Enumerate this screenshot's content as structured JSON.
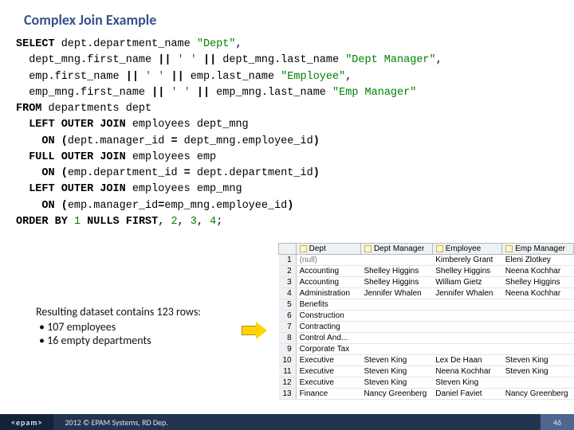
{
  "slide": {
    "title": "Complex Join Example",
    "sql_html": "<span class=\"kw\">SELECT</span> dept.department_name <span class=\"str\">\"Dept\"</span>,\n  dept_mng.first_name <span class=\"kw\">||</span> <span class=\"str\">' '</span> <span class=\"kw\">||</span> dept_mng.last_name <span class=\"str\">\"Dept Manager\"</span>,\n  emp.first_name <span class=\"kw\">||</span> <span class=\"str\">' '</span> <span class=\"kw\">||</span> emp.last_name <span class=\"str\">\"Employee\"</span>,\n  emp_mng.first_name <span class=\"kw\">||</span> <span class=\"str\">' '</span> <span class=\"kw\">||</span> emp_mng.last_name <span class=\"str\">\"Emp Manager\"</span>\n<span class=\"kw\">FROM</span> departments dept\n  <span class=\"kw\">LEFT OUTER JOIN</span> employees dept_mng\n    <span class=\"kw\">ON</span> <span class=\"kw\">(</span>dept.manager_id <span class=\"kw\">=</span> dept_mng.employee_id<span class=\"kw\">)</span>\n  <span class=\"kw\">FULL OUTER JOIN</span> employees emp\n    <span class=\"kw\">ON</span> <span class=\"kw\">(</span>emp.department_id <span class=\"kw\">=</span> dept.department_id<span class=\"kw\">)</span>\n  <span class=\"kw\">LEFT OUTER JOIN</span> employees emp_mng\n    <span class=\"kw\">ON</span> <span class=\"kw\">(</span>emp.manager_id<span class=\"kw\">=</span>emp_mng.employee_id<span class=\"kw\">)</span>\n<span class=\"kw\">ORDER BY</span> <span class=\"str\">1</span> <span class=\"kw\">NULLS FIRST</span>, <span class=\"str\">2</span>, <span class=\"str\">3</span>, <span class=\"str\">4</span>;",
    "summary": {
      "line": "Resulting dataset contains 123 rows:",
      "bullets": [
        "107 employees",
        "16 empty departments"
      ]
    },
    "table": {
      "headers": [
        "Dept",
        "Dept Manager",
        "Employee",
        "Emp Manager"
      ],
      "rows": [
        {
          "n": "1",
          "dept": "(null)",
          "dept_null": true,
          "dm": "",
          "emp": "Kimberely Grant",
          "em": "Eleni Zlotkey"
        },
        {
          "n": "2",
          "dept": "Accounting",
          "dm": "Shelley Higgins",
          "emp": "Shelley Higgins",
          "em": "Neena Kochhar"
        },
        {
          "n": "3",
          "dept": "Accounting",
          "dm": "Shelley Higgins",
          "emp": "William Gietz",
          "em": "Shelley Higgins"
        },
        {
          "n": "4",
          "dept": "Administration",
          "dm": "Jennifer Whalen",
          "emp": "Jennifer Whalen",
          "em": "Neena Kochhar"
        },
        {
          "n": "5",
          "dept": "Benefits",
          "dm": "",
          "emp": "",
          "em": ""
        },
        {
          "n": "6",
          "dept": "Construction",
          "dm": "",
          "emp": "",
          "em": ""
        },
        {
          "n": "7",
          "dept": "Contracting",
          "dm": "",
          "emp": "",
          "em": ""
        },
        {
          "n": "8",
          "dept": "Control And...",
          "dm": "",
          "emp": "",
          "em": ""
        },
        {
          "n": "9",
          "dept": "Corporate Tax",
          "dm": "",
          "emp": "",
          "em": ""
        },
        {
          "n": "10",
          "dept": "Executive",
          "dm": "Steven King",
          "emp": "Lex De Haan",
          "em": "Steven King"
        },
        {
          "n": "11",
          "dept": "Executive",
          "dm": "Steven King",
          "emp": "Neena Kochhar",
          "em": "Steven King"
        },
        {
          "n": "12",
          "dept": "Executive",
          "dm": "Steven King",
          "emp": "Steven King",
          "em": ""
        },
        {
          "n": "13",
          "dept": "Finance",
          "dm": "Nancy Greenberg",
          "emp": "Daniel Faviet",
          "em": "Nancy Greenberg"
        }
      ]
    }
  },
  "footer": {
    "brand": "<epam>",
    "copy": "2012 © EPAM Systems, RD Dep.",
    "page": "46"
  }
}
